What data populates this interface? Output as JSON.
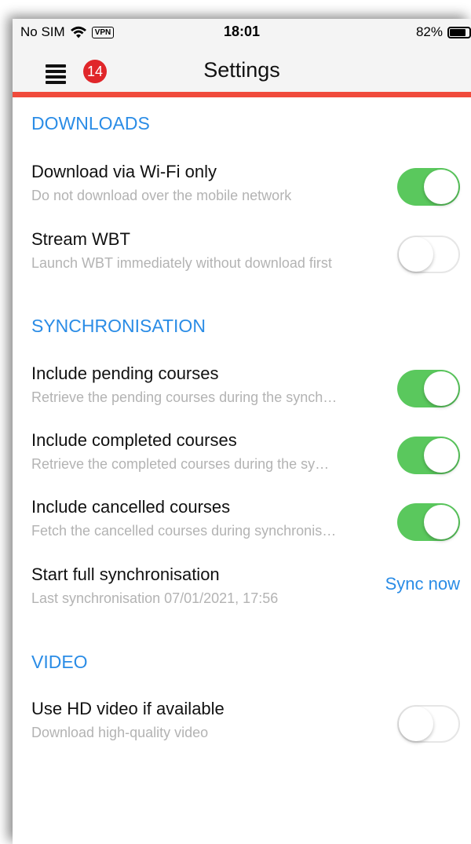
{
  "status_bar": {
    "carrier": "No SIM",
    "vpn": "VPN",
    "time": "18:01",
    "battery": "82%",
    "battery_level": 0.82
  },
  "header": {
    "title": "Settings",
    "menu_badge": "14",
    "accent_color": "#f04a3b"
  },
  "colors": {
    "section_header": "#2a8ce6",
    "toggle_on": "#5ac85d",
    "badge": "#e0262a"
  },
  "sections": {
    "downloads": {
      "header": "DOWNLOADS",
      "wifi_only": {
        "title": "Download via Wi-Fi only",
        "subtitle": "Do not download over the mobile network",
        "enabled": true
      },
      "stream_wbt": {
        "title": "Stream WBT",
        "subtitle": "Launch WBT immediately without download first",
        "enabled": false
      }
    },
    "synchronisation": {
      "header": "SYNCHRONISATION",
      "pending": {
        "title": "Include pending courses",
        "subtitle": "Retrieve the pending courses during the synch…",
        "enabled": true
      },
      "completed": {
        "title": "Include completed courses",
        "subtitle": "Retrieve the completed courses during the sy…",
        "enabled": true
      },
      "cancelled": {
        "title": "Include cancelled courses",
        "subtitle": "Fetch the cancelled courses during synchronis…",
        "enabled": true
      },
      "full_sync": {
        "title": "Start full synchronisation",
        "subtitle": "Last synchronisation 07/01/2021, 17:56",
        "action": "Sync now"
      }
    },
    "video": {
      "header": "VIDEO",
      "hd": {
        "title": "Use HD video if available",
        "subtitle": "Download high-quality video",
        "enabled": false
      }
    }
  }
}
